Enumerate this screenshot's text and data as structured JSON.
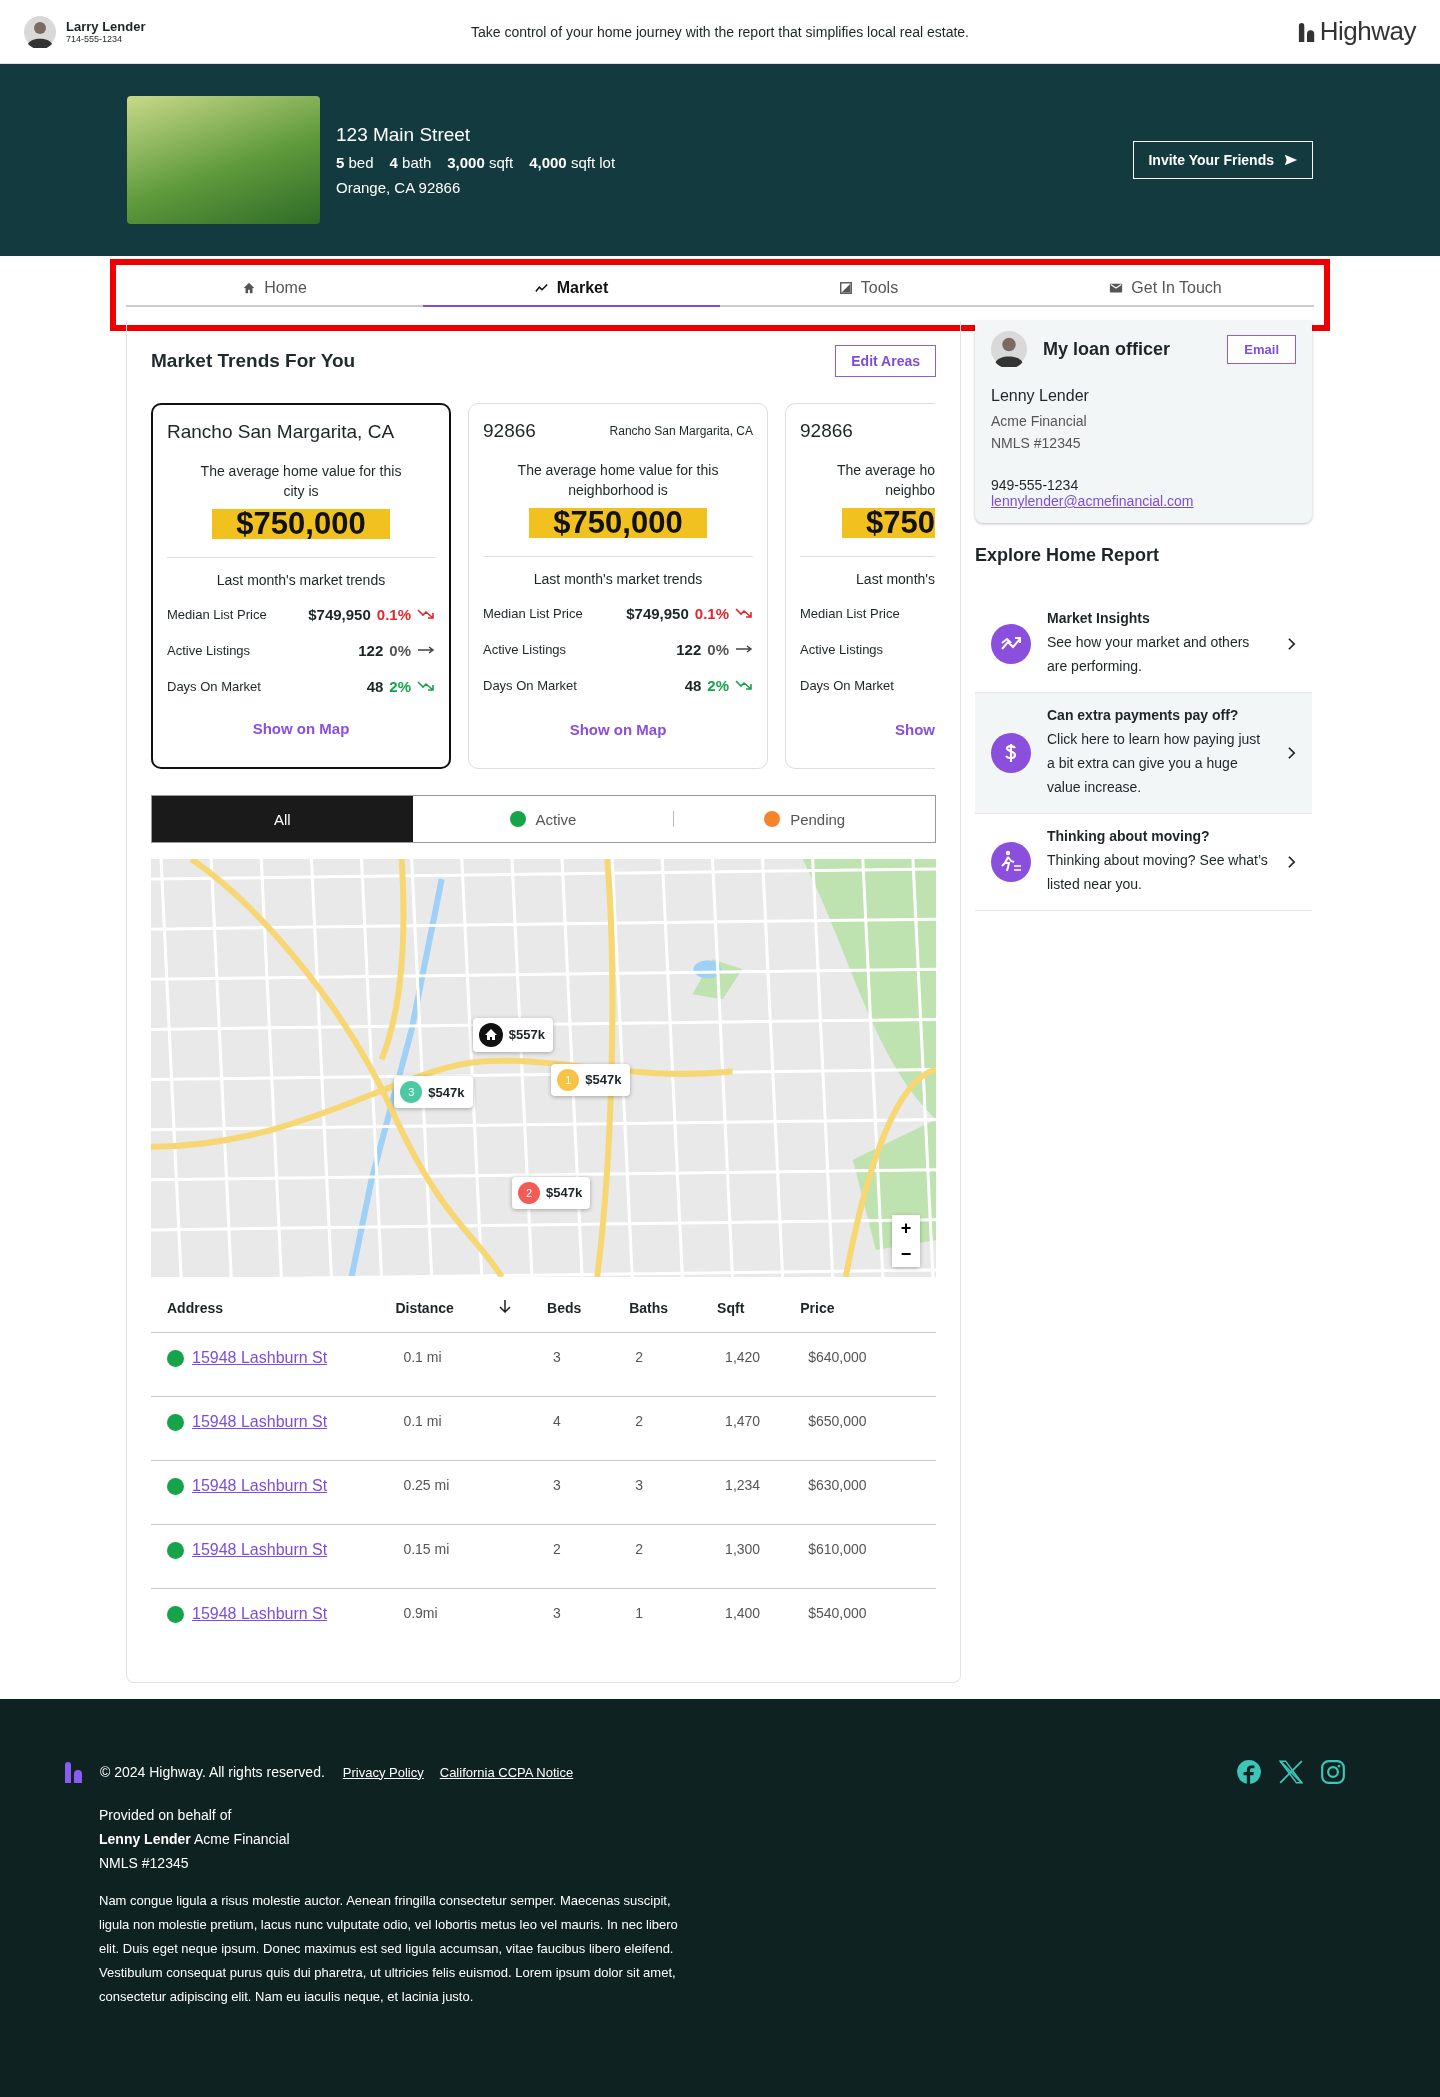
{
  "header": {
    "agent": {
      "name": "Larry Lender",
      "phone": "714-555-1234"
    },
    "tagline": "Take control of your home journey with the report that simplifies local real estate.",
    "logo": "Highway"
  },
  "property": {
    "address": "123 Main Street",
    "stats": [
      {
        "value": "5",
        "unit": "bed"
      },
      {
        "value": "4",
        "unit": "bath"
      },
      {
        "value": "3,000",
        "unit": "sqft"
      },
      {
        "value": "4,000",
        "unit": "sqft lot"
      }
    ],
    "city": "Orange, CA 92866",
    "invite_button": "Invite Your Friends"
  },
  "tab_bar": {
    "highlighted": true,
    "tabs": [
      {
        "label": "Home",
        "selected": false
      },
      {
        "label": "Market",
        "selected": true
      },
      {
        "label": "Tools",
        "selected": false
      },
      {
        "label": "Get In Touch",
        "selected": false
      }
    ]
  },
  "market": {
    "title": "Market Trends For You",
    "edit_button": "Edit Areas",
    "cards": [
      {
        "selected": true,
        "title": "Rancho San Margarita, CA",
        "description": "The average home value for this city is",
        "value": "$750,000",
        "trends_title": "Last month's market trends",
        "metrics": [
          {
            "label": "Median List Price",
            "value": "$749,950",
            "change": "0.1%",
            "kind": "negative"
          },
          {
            "label": "Active Listings",
            "value": "122",
            "change": "0%",
            "kind": "neutral"
          },
          {
            "label": "Days On Market",
            "value": "48",
            "change": "2%",
            "kind": "positive"
          }
        ],
        "link": "Show on Map"
      },
      {
        "selected": false,
        "title": "92866",
        "subtitle": "Rancho San Margarita, CA",
        "description": "The average home value for this neighborhood is",
        "value": "$750,000",
        "trends_title": "Last month's market trends",
        "metrics": [
          {
            "label": "Median List Price",
            "value": "$749,950",
            "change": "0.1%",
            "kind": "negative"
          },
          {
            "label": "Active Listings",
            "value": "122",
            "change": "0%",
            "kind": "neutral"
          },
          {
            "label": "Days On Market",
            "value": "48",
            "change": "2%",
            "kind": "positive"
          }
        ],
        "link": "Show on Map"
      },
      {
        "selected": false,
        "partial": true,
        "title": "92866",
        "description_lines": [
          "The average ho",
          "neighbo"
        ],
        "value": "$750",
        "trends_title": "Last month's",
        "metrics": [
          {
            "label": "Median List Price"
          },
          {
            "label": "Active Listings"
          },
          {
            "label": "Days On Market"
          }
        ],
        "link": "Show"
      }
    ]
  },
  "filters": [
    {
      "label": "All",
      "selected": true
    },
    {
      "label": "Active",
      "selected": false,
      "color": "#16a34a"
    },
    {
      "label": "Pending",
      "selected": false,
      "color": "#f5842a"
    }
  ],
  "map": {
    "markers": [
      {
        "kind": "home",
        "label": "$557k"
      },
      {
        "kind": "numbered",
        "number": "1",
        "label": "$547k",
        "color": "#f6c344"
      },
      {
        "kind": "numbered",
        "number": "3",
        "label": "$547k",
        "color": "#4cc9a4"
      },
      {
        "kind": "numbered",
        "number": "2",
        "label": "$547k",
        "color": "#f25c54"
      }
    ],
    "zoom_in": "+",
    "zoom_out": "−"
  },
  "table": {
    "columns": [
      {
        "label": "Address",
        "sorted": false
      },
      {
        "label": "Distance",
        "sorted": true
      },
      {
        "label": "Beds",
        "sorted": false
      },
      {
        "label": "Baths",
        "sorted": false
      },
      {
        "label": "Sqft",
        "sorted": false
      },
      {
        "label": "Price",
        "sorted": false
      }
    ],
    "rows": [
      {
        "color": "#16a34a",
        "address": "15948 Lashburn St",
        "distance": "0.1 mi",
        "beds": "3",
        "baths": "2",
        "sqft": "1,420",
        "price": "$640,000"
      },
      {
        "color": "#16a34a",
        "address": "15948 Lashburn St",
        "distance": "0.1 mi",
        "beds": "4",
        "baths": "2",
        "sqft": "1,470",
        "price": "$650,000"
      },
      {
        "color": "#16a34a",
        "address": "15948 Lashburn St",
        "distance": "0.25 mi",
        "beds": "3",
        "baths": "3",
        "sqft": "1,234",
        "price": "$630,000"
      },
      {
        "color": "#16a34a",
        "address": "15948 Lashburn St",
        "distance": "0.15 mi",
        "beds": "2",
        "baths": "2",
        "sqft": "1,300",
        "price": "$610,000"
      },
      {
        "color": "#16a34a",
        "address": "15948 Lashburn St",
        "distance": "0.9mi",
        "beds": "3",
        "baths": "1",
        "sqft": "1,400",
        "price": "$540,000"
      }
    ]
  },
  "loan_officer": {
    "title": "My loan officer",
    "email_button": "Email",
    "name": "Lenny Lender",
    "company": "Acme Financial",
    "nmls": "NMLS #12345",
    "phone": "949-555-1234",
    "email": "lennylender@acmefinancial.com"
  },
  "explore": {
    "title": "Explore Home Report",
    "items": [
      {
        "title": "Market Insights",
        "text": "See how your market and others are performing.",
        "highlighted": false
      },
      {
        "title": "Can extra payments pay off?",
        "text": "Click here to learn how paying just a bit extra can give you a huge value increase.",
        "highlighted": true
      },
      {
        "title": "Thinking about moving?",
        "text": "Thinking about moving? See what’s listed near you.",
        "highlighted": false
      }
    ]
  },
  "footer": {
    "copyright": "© 2024 Highway. All rights reserved.",
    "links": [
      "Privacy Policy",
      "California CCPA Notice"
    ],
    "provided_lines": [
      "Provided on behalf of",
      "**Lenny Lender** Acme Financial",
      "NMLS #12345"
    ],
    "disclaimer": "Nam congue ligula a risus molestie auctor. Aenean fringilla consectetur  semper. Maecenas suscipit, ligula non molestie pretium, lacus nunc  vulputate odio, vel lobortis metus leo vel mauris. In nec libero elit.  Duis eget neque ipsum. Donec maximus est sed ligula accumsan, vitae  faucibus libero eleifend. Vestibulum consequat purus quis dui pharetra,  ut ultricies felis euismod. Lorem ipsum dolor sit amet, consectetur  adipiscing elit. Nam eu iaculis neque, et lacinia justo."
  }
}
